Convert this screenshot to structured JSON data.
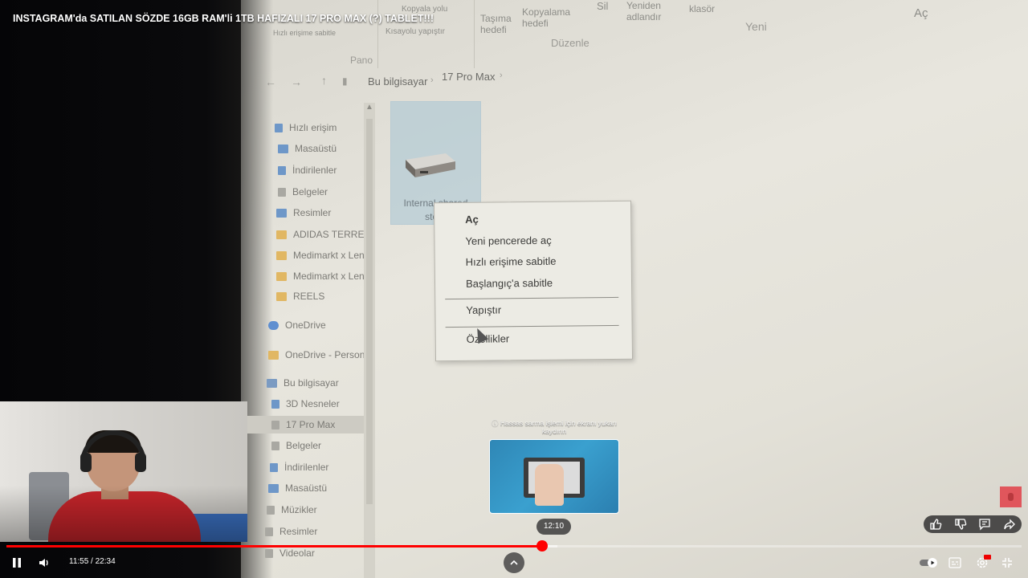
{
  "video": {
    "title": "INSTAGRAM'da SATILAN SÖZDE 16GB RAM'li 1TB HAFIZALI 17 PRO MAX (?) TABLET!!!",
    "current_time": "11:55",
    "duration": "22:34",
    "time_display": "11:55 / 22:34",
    "progress_fraction": 0.528,
    "preview_time": "12:10",
    "seek_hint": "Hassas sarma işlemi için ekranı yukarı kaydırın",
    "colors": {
      "accent": "#ff0000",
      "overlay": "#3c3c3c"
    }
  },
  "explorer": {
    "ribbon": {
      "row1": [
        "Taşıma hedefi",
        "Kopyalama hedefi",
        "Sil",
        "Yeniden adlandır",
        "klasör",
        "Aç"
      ],
      "group_duzenle": "Düzenle",
      "group_yeni": "Yeni",
      "group_pano": "Pano",
      "small_copy_path": "Kopyala yolu",
      "small_paste_shortcut": "Kısayolu yapıştır",
      "small_left": "Hızlı erişime sabitle"
    },
    "breadcrumb": [
      "Bu bilgisayar",
      "17 Pro Max"
    ],
    "nav": {
      "quick_access": "Hızlı erişim",
      "items": [
        {
          "label": "Masaüstü",
          "icon": "desktop-icon"
        },
        {
          "label": "İndirilenler",
          "icon": "download-icon"
        },
        {
          "label": "Belgeler",
          "icon": "documents-icon"
        },
        {
          "label": "Resimler",
          "icon": "pictures-icon"
        },
        {
          "label": "ADIDAS TERREX",
          "icon": "folder-icon"
        },
        {
          "label": "Medimarkt x Len",
          "icon": "folder-icon"
        },
        {
          "label": "Medimarkt x Len",
          "icon": "folder-icon"
        },
        {
          "label": "REELS",
          "icon": "folder-icon"
        }
      ],
      "onedrive": "OneDrive",
      "onedrive_personal": "OneDrive - Person",
      "this_pc": "Bu bilgisayar",
      "pc_items": [
        "3D Nesneler",
        "17 Pro Max",
        "Belgeler",
        "İndirilenler",
        "Masaüstü",
        "Müzikler",
        "Resimler",
        "Videolar"
      ]
    },
    "drive": {
      "line1": "Internal shared",
      "line2": "stora",
      "icon": "hard-drive-icon"
    },
    "context_menu": {
      "items": [
        "Aç",
        "Yeni pencerede aç",
        "Hızlı erişime sabitle",
        "Başlangıç'a sabitle"
      ],
      "paste": "Yapıştır",
      "properties": "Özellikler"
    }
  },
  "controls": {
    "pause_icon": "pause-icon",
    "volume_icon": "volume-icon",
    "chevron_icon": "chevron-up-icon",
    "like_icon": "thumbs-up-icon",
    "dislike_icon": "thumbs-down-icon",
    "comment_icon": "comment-icon",
    "share_icon": "share-icon",
    "autoplay_icon": "autoplay-toggle-icon",
    "captions_icon": "captions-icon",
    "settings_icon": "settings-gear-icon",
    "fullscreen_exit_icon": "exit-fullscreen-icon"
  }
}
